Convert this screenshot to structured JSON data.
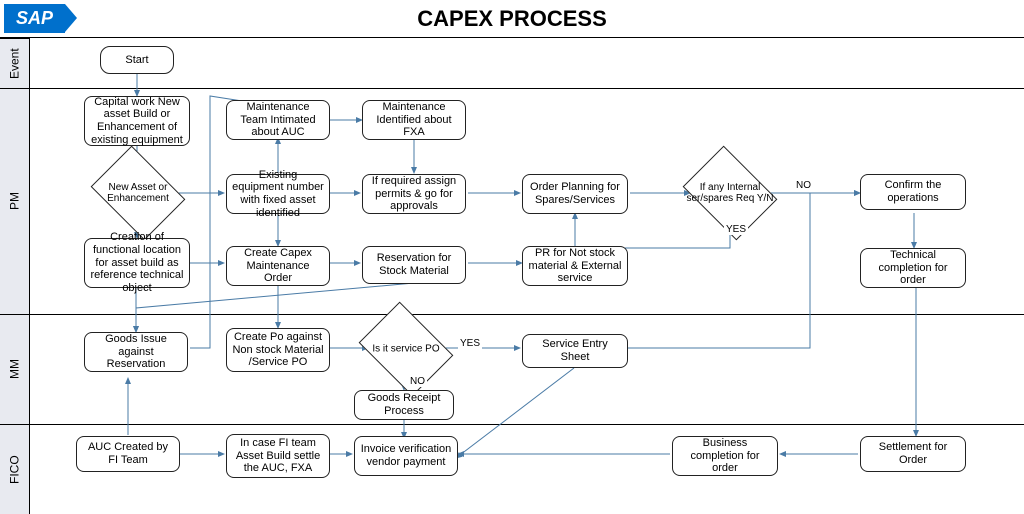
{
  "header": {
    "logo": "SAP",
    "title": "CAPEX PROCESS"
  },
  "lanes": {
    "event": "Event",
    "pm": "PM",
    "mm": "MM",
    "fico": "FICO"
  },
  "nodes": {
    "start": "Start",
    "capwork": "Capital work New asset Build or Enhancement of existing equipment",
    "maint_auc": "Maintenance Team Intimated about AUC",
    "maint_fxa": "Maintenance Identified about FXA",
    "dec_asset": "New Asset or Enhancement",
    "existing_eq": "Existing equipment number with fixed asset identified",
    "assign_permits": "If required assign permits & go for approvals",
    "order_plan": "Order Planning for Spares/Services",
    "dec_spares": "If any Internal ser/spares Req Y/N",
    "confirm_ops": "Confirm the operations",
    "func_loc": "Creation of functional location for asset build as reference technical object",
    "create_capex": "Create Capex Maintenance Order",
    "reservation": "Reservation for Stock Material",
    "pr_nonstock": "PR for Not stock material & External service",
    "tech_complete": "Technical completion for order",
    "goods_issue": "Goods Issue against Reservation",
    "create_po": "Create Po against Non stock Material /Service PO",
    "dec_service": "Is it service PO",
    "service_entry": "Service Entry Sheet",
    "goods_receipt": "Goods Receipt Process",
    "auc_created": "AUC Created by FI Team",
    "settle_auc": "In case FI team Asset Build  settle the AUC, FXA",
    "invoice": "Invoice verification vendor payment",
    "biz_complete": "Business completion for order",
    "settlement": "Settlement for Order"
  },
  "edges": {
    "yes": "YES",
    "no": "NO"
  }
}
